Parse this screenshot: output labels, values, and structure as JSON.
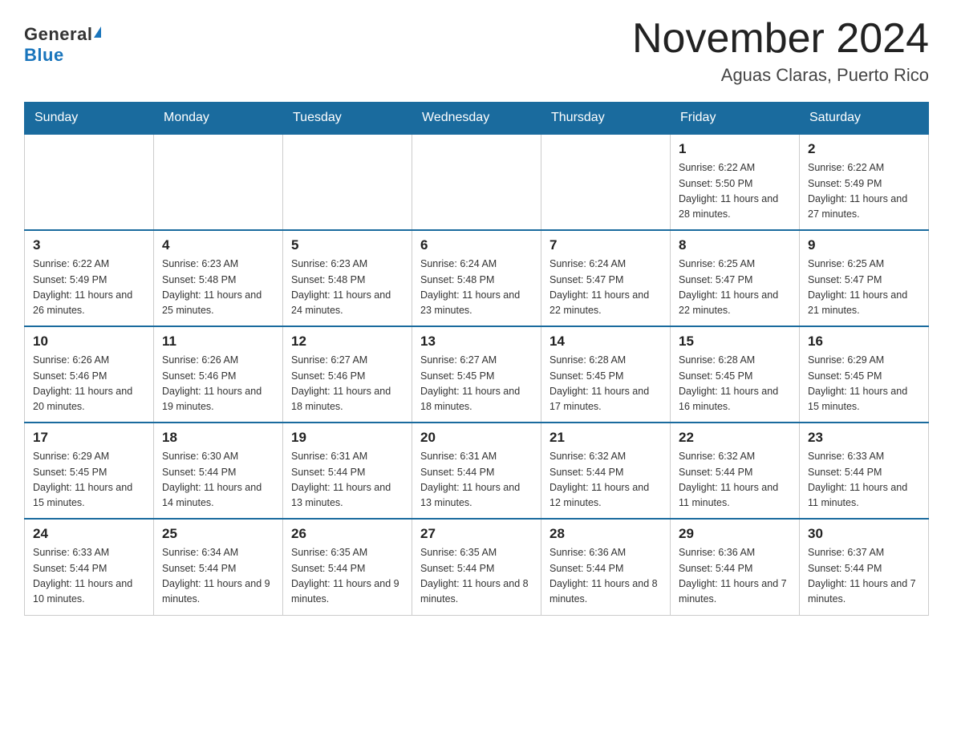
{
  "header": {
    "logo_general": "General",
    "logo_blue": "Blue",
    "month_title": "November 2024",
    "location": "Aguas Claras, Puerto Rico"
  },
  "weekdays": [
    "Sunday",
    "Monday",
    "Tuesday",
    "Wednesday",
    "Thursday",
    "Friday",
    "Saturday"
  ],
  "weeks": [
    [
      {
        "day": "",
        "info": ""
      },
      {
        "day": "",
        "info": ""
      },
      {
        "day": "",
        "info": ""
      },
      {
        "day": "",
        "info": ""
      },
      {
        "day": "",
        "info": ""
      },
      {
        "day": "1",
        "info": "Sunrise: 6:22 AM\nSunset: 5:50 PM\nDaylight: 11 hours and 28 minutes."
      },
      {
        "day": "2",
        "info": "Sunrise: 6:22 AM\nSunset: 5:49 PM\nDaylight: 11 hours and 27 minutes."
      }
    ],
    [
      {
        "day": "3",
        "info": "Sunrise: 6:22 AM\nSunset: 5:49 PM\nDaylight: 11 hours and 26 minutes."
      },
      {
        "day": "4",
        "info": "Sunrise: 6:23 AM\nSunset: 5:48 PM\nDaylight: 11 hours and 25 minutes."
      },
      {
        "day": "5",
        "info": "Sunrise: 6:23 AM\nSunset: 5:48 PM\nDaylight: 11 hours and 24 minutes."
      },
      {
        "day": "6",
        "info": "Sunrise: 6:24 AM\nSunset: 5:48 PM\nDaylight: 11 hours and 23 minutes."
      },
      {
        "day": "7",
        "info": "Sunrise: 6:24 AM\nSunset: 5:47 PM\nDaylight: 11 hours and 22 minutes."
      },
      {
        "day": "8",
        "info": "Sunrise: 6:25 AM\nSunset: 5:47 PM\nDaylight: 11 hours and 22 minutes."
      },
      {
        "day": "9",
        "info": "Sunrise: 6:25 AM\nSunset: 5:47 PM\nDaylight: 11 hours and 21 minutes."
      }
    ],
    [
      {
        "day": "10",
        "info": "Sunrise: 6:26 AM\nSunset: 5:46 PM\nDaylight: 11 hours and 20 minutes."
      },
      {
        "day": "11",
        "info": "Sunrise: 6:26 AM\nSunset: 5:46 PM\nDaylight: 11 hours and 19 minutes."
      },
      {
        "day": "12",
        "info": "Sunrise: 6:27 AM\nSunset: 5:46 PM\nDaylight: 11 hours and 18 minutes."
      },
      {
        "day": "13",
        "info": "Sunrise: 6:27 AM\nSunset: 5:45 PM\nDaylight: 11 hours and 18 minutes."
      },
      {
        "day": "14",
        "info": "Sunrise: 6:28 AM\nSunset: 5:45 PM\nDaylight: 11 hours and 17 minutes."
      },
      {
        "day": "15",
        "info": "Sunrise: 6:28 AM\nSunset: 5:45 PM\nDaylight: 11 hours and 16 minutes."
      },
      {
        "day": "16",
        "info": "Sunrise: 6:29 AM\nSunset: 5:45 PM\nDaylight: 11 hours and 15 minutes."
      }
    ],
    [
      {
        "day": "17",
        "info": "Sunrise: 6:29 AM\nSunset: 5:45 PM\nDaylight: 11 hours and 15 minutes."
      },
      {
        "day": "18",
        "info": "Sunrise: 6:30 AM\nSunset: 5:44 PM\nDaylight: 11 hours and 14 minutes."
      },
      {
        "day": "19",
        "info": "Sunrise: 6:31 AM\nSunset: 5:44 PM\nDaylight: 11 hours and 13 minutes."
      },
      {
        "day": "20",
        "info": "Sunrise: 6:31 AM\nSunset: 5:44 PM\nDaylight: 11 hours and 13 minutes."
      },
      {
        "day": "21",
        "info": "Sunrise: 6:32 AM\nSunset: 5:44 PM\nDaylight: 11 hours and 12 minutes."
      },
      {
        "day": "22",
        "info": "Sunrise: 6:32 AM\nSunset: 5:44 PM\nDaylight: 11 hours and 11 minutes."
      },
      {
        "day": "23",
        "info": "Sunrise: 6:33 AM\nSunset: 5:44 PM\nDaylight: 11 hours and 11 minutes."
      }
    ],
    [
      {
        "day": "24",
        "info": "Sunrise: 6:33 AM\nSunset: 5:44 PM\nDaylight: 11 hours and 10 minutes."
      },
      {
        "day": "25",
        "info": "Sunrise: 6:34 AM\nSunset: 5:44 PM\nDaylight: 11 hours and 9 minutes."
      },
      {
        "day": "26",
        "info": "Sunrise: 6:35 AM\nSunset: 5:44 PM\nDaylight: 11 hours and 9 minutes."
      },
      {
        "day": "27",
        "info": "Sunrise: 6:35 AM\nSunset: 5:44 PM\nDaylight: 11 hours and 8 minutes."
      },
      {
        "day": "28",
        "info": "Sunrise: 6:36 AM\nSunset: 5:44 PM\nDaylight: 11 hours and 8 minutes."
      },
      {
        "day": "29",
        "info": "Sunrise: 6:36 AM\nSunset: 5:44 PM\nDaylight: 11 hours and 7 minutes."
      },
      {
        "day": "30",
        "info": "Sunrise: 6:37 AM\nSunset: 5:44 PM\nDaylight: 11 hours and 7 minutes."
      }
    ]
  ]
}
